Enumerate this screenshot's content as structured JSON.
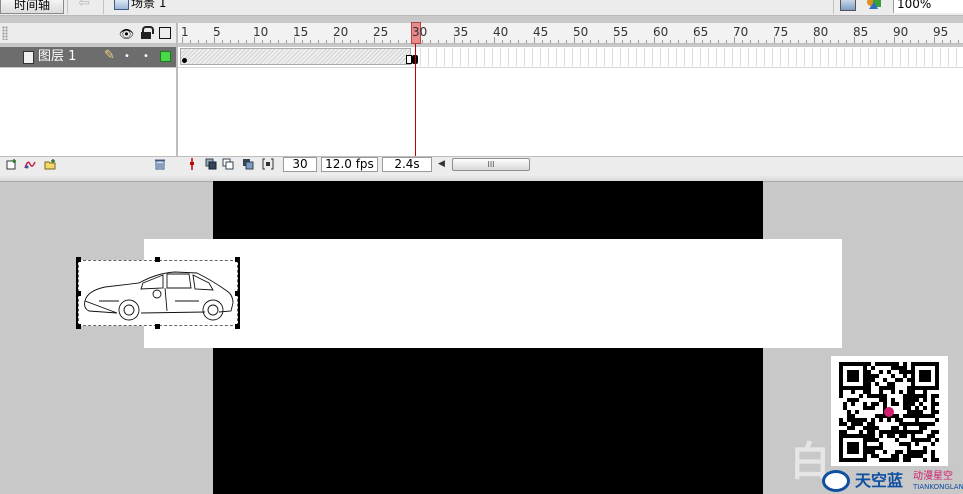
{
  "topbar": {
    "timeline_tab": "时间轴",
    "scene_label": "场景 1",
    "zoom": "100%"
  },
  "timeline": {
    "ruler_numbers": [
      "1",
      "5",
      "10",
      "15",
      "20",
      "25",
      "30",
      "35",
      "40",
      "45",
      "50",
      "55",
      "60",
      "65",
      "70",
      "75",
      "80",
      "85",
      "90",
      "95"
    ],
    "playhead_frame": "30",
    "layer": {
      "name": "图层 1",
      "color": "#49d849"
    },
    "current_frame": "30",
    "frame_rate": "12.0 fps",
    "elapsed_time": "2.4s",
    "scroll_thumb": "III"
  },
  "stage": {
    "background": "#000000",
    "qr_code_icon": "qr-code",
    "watermark": {
      "brand": "天空蓝",
      "sub_cn": "动漫星空",
      "sub_en": "TIANKONGLAN"
    }
  }
}
